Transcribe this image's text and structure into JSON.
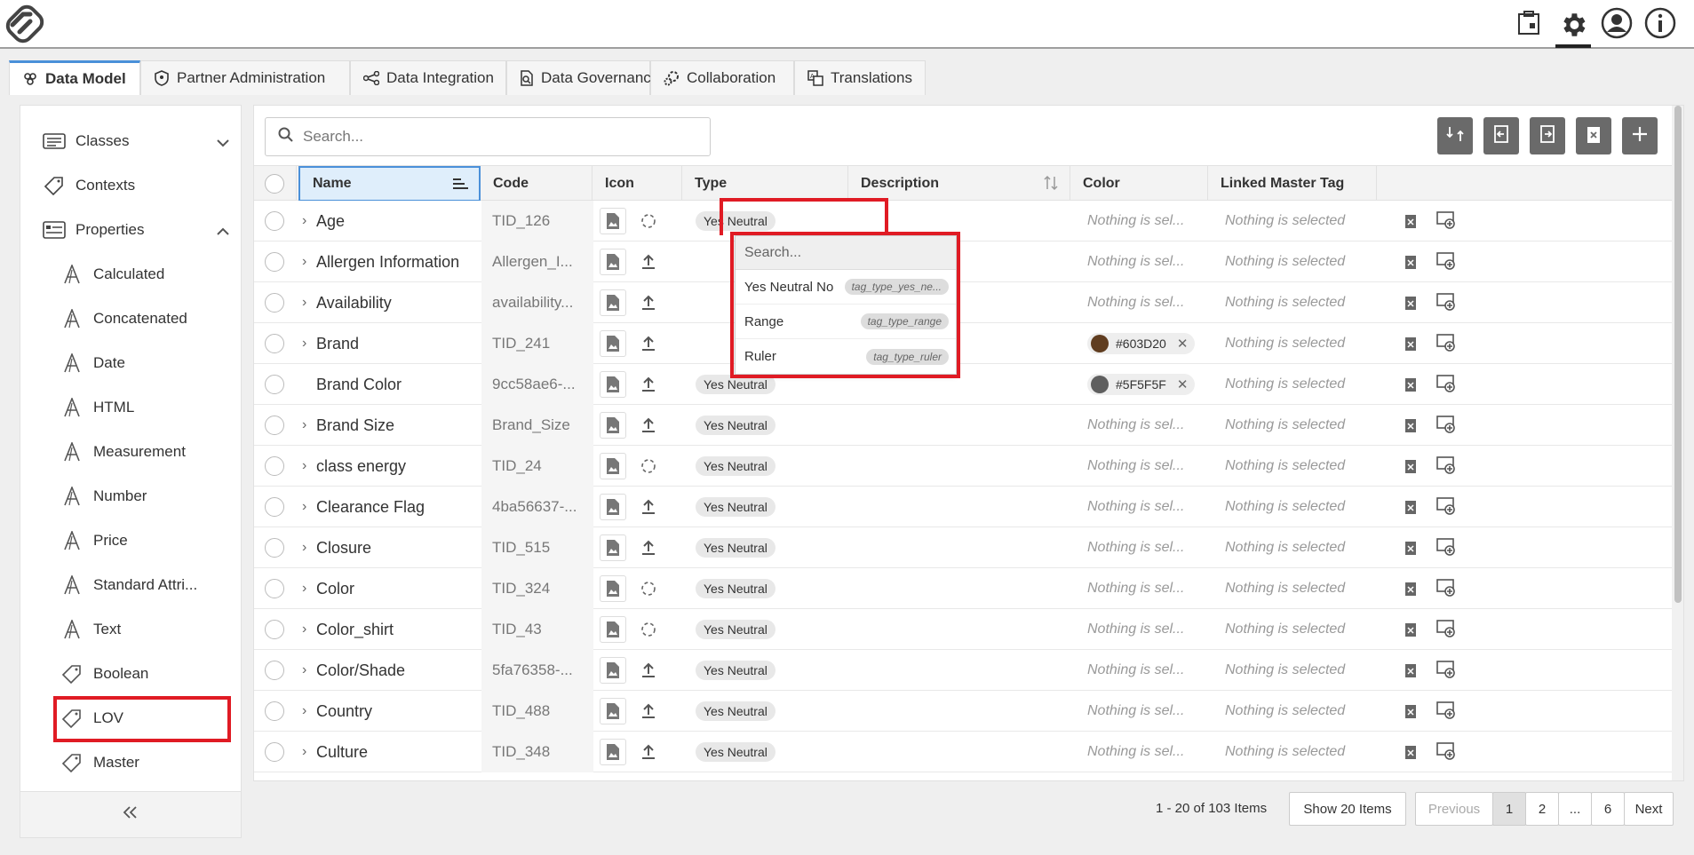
{
  "tabs": [
    {
      "label": "Data Model",
      "icon": "cubes-icon"
    },
    {
      "label": "Partner Administration",
      "icon": "shield-icon"
    },
    {
      "label": "Data Integration",
      "icon": "share-icon"
    },
    {
      "label": "Data Governance",
      "icon": "doc-search-icon"
    },
    {
      "label": "Collaboration",
      "icon": "gears-icon"
    },
    {
      "label": "Translations",
      "icon": "translate-icon"
    }
  ],
  "sidebar": {
    "items": [
      {
        "label": "Classes"
      },
      {
        "label": "Contexts"
      },
      {
        "label": "Properties"
      },
      {
        "label": "Calculated"
      },
      {
        "label": "Concatenated"
      },
      {
        "label": "Date"
      },
      {
        "label": "HTML"
      },
      {
        "label": "Measurement"
      },
      {
        "label": "Number"
      },
      {
        "label": "Price"
      },
      {
        "label": "Standard Attri..."
      },
      {
        "label": "Text"
      },
      {
        "label": "Boolean"
      },
      {
        "label": "LOV"
      },
      {
        "label": "Master"
      }
    ]
  },
  "search": {
    "placeholder": "Search..."
  },
  "columns": {
    "name": "Name",
    "code": "Code",
    "icon": "Icon",
    "type": "Type",
    "description": "Description",
    "color": "Color",
    "linked": "Linked Master Tag"
  },
  "rows": [
    {
      "name": "Age",
      "code": "TID_126",
      "type": "Yes Neutral",
      "color": "Nothing is sel...",
      "linked": "Nothing is selected"
    },
    {
      "name": "Allergen Information",
      "code": "Allergen_I...",
      "type": "",
      "color": "Nothing is sel...",
      "linked": "Nothing is selected"
    },
    {
      "name": "Availability",
      "code": "availability...",
      "type": "",
      "color": "Nothing is sel...",
      "linked": "Nothing is selected"
    },
    {
      "name": "Brand",
      "code": "TID_241",
      "type": "",
      "color": "#603D20",
      "linked": "Nothing is selected"
    },
    {
      "name": "Brand Color",
      "code": "9cc58ae6-...",
      "type": "Yes Neutral",
      "color": "#5F5F5F",
      "linked": "Nothing is selected"
    },
    {
      "name": "Brand Size",
      "code": "Brand_Size",
      "type": "Yes Neutral",
      "color": "Nothing is sel...",
      "linked": "Nothing is selected"
    },
    {
      "name": "class energy",
      "code": "TID_24",
      "type": "Yes Neutral",
      "color": "Nothing is sel...",
      "linked": "Nothing is selected"
    },
    {
      "name": "Clearance Flag",
      "code": "4ba56637-...",
      "type": "Yes Neutral",
      "color": "Nothing is sel...",
      "linked": "Nothing is selected"
    },
    {
      "name": "Closure",
      "code": "TID_515",
      "type": "Yes Neutral",
      "color": "Nothing is sel...",
      "linked": "Nothing is selected"
    },
    {
      "name": "Color",
      "code": "TID_324",
      "type": "Yes Neutral",
      "color": "Nothing is sel...",
      "linked": "Nothing is selected"
    },
    {
      "name": "Color_shirt",
      "code": "TID_43",
      "type": "Yes Neutral",
      "color": "Nothing is sel...",
      "linked": "Nothing is selected"
    },
    {
      "name": "Color/Shade",
      "code": "5fa76358-...",
      "type": "Yes Neutral",
      "color": "Nothing is sel...",
      "linked": "Nothing is selected"
    },
    {
      "name": "Country",
      "code": "TID_488",
      "type": "Yes Neutral",
      "color": "Nothing is sel...",
      "linked": "Nothing is selected"
    },
    {
      "name": "Culture",
      "code": "TID_348",
      "type": "Yes Neutral",
      "color": "Nothing is sel...",
      "linked": "Nothing is selected"
    }
  ],
  "dropdown": {
    "placeholder": "Search...",
    "options": [
      {
        "label": "Yes Neutral No",
        "tag": "tag_type_yes_ne..."
      },
      {
        "label": "Range",
        "tag": "tag_type_range"
      },
      {
        "label": "Ruler",
        "tag": "tag_type_ruler"
      }
    ]
  },
  "footer": {
    "range": "1 - 20 of 103 Items",
    "show": "Show 20 Items",
    "previous": "Previous",
    "pages": [
      "1",
      "2",
      "...",
      "6"
    ],
    "next": "Next"
  },
  "colors": {
    "accent": "#4a90d9",
    "highlight": "#e01b24",
    "chip1": "#603D20",
    "chip2": "#5F5F5F"
  }
}
